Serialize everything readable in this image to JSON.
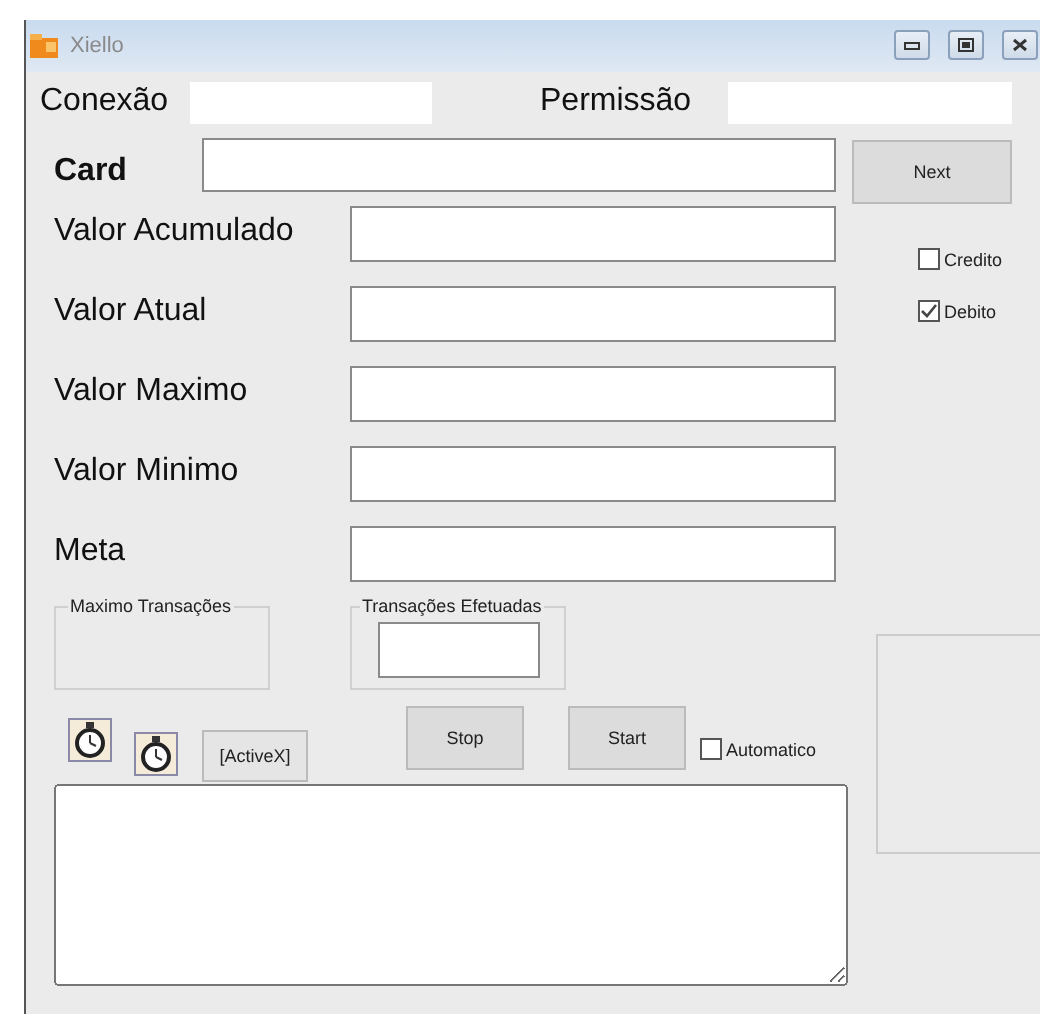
{
  "window": {
    "title": "Xiello"
  },
  "header": {
    "connection_label": "Conexão",
    "permission_label": "Permissão"
  },
  "card": {
    "label": "Card",
    "button": "Next"
  },
  "fields": [
    {
      "label": "Valor Acumulado"
    },
    {
      "label": "Valor Atual"
    },
    {
      "label": "Valor Maximo"
    },
    {
      "label": "Valor Minimo"
    },
    {
      "label": "Meta"
    }
  ],
  "options": [
    {
      "label": "Credito",
      "checked": false
    },
    {
      "label": "Debito",
      "checked": true
    }
  ],
  "groups": [
    {
      "title": "Maximo Transações",
      "kind": "empty"
    },
    {
      "title": "Transações Efetuadas",
      "kind": "field"
    }
  ],
  "toolbar": {
    "activex": "[ActiveX]",
    "stop": "Stop",
    "start": "Start",
    "automatic": {
      "label": "Automatico",
      "checked": false
    }
  }
}
